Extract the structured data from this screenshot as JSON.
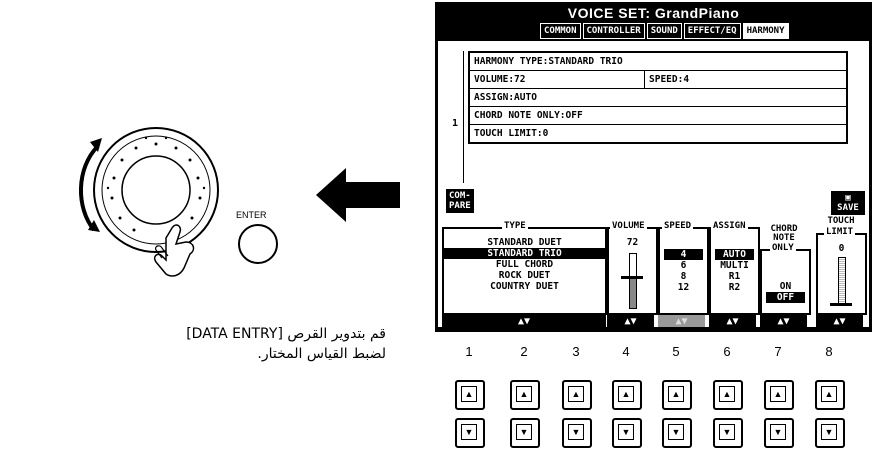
{
  "dial": {
    "enter_label": "ENTER"
  },
  "caption": {
    "line1": "قم بتدوير القرص [DATA ENTRY]",
    "line2": "لضبط القياس المختار."
  },
  "screen": {
    "title": "VOICE SET: GrandPiano",
    "tabs": [
      {
        "label": "COMMON",
        "state": "normal"
      },
      {
        "label": "CONTROLLER",
        "state": "normal"
      },
      {
        "label": "SOUND",
        "state": "normal"
      },
      {
        "label": "EFFECT/EQ",
        "state": "normal"
      },
      {
        "label": "HARMONY",
        "state": "active"
      }
    ],
    "index": "1",
    "rows": {
      "harmony_type": "HARMONY TYPE:STANDARD TRIO",
      "volume": "VOLUME:72",
      "speed": "SPEED:4",
      "assign": "ASSIGN:AUTO",
      "chord_note_only": "CHORD NOTE ONLY:OFF",
      "touch_limit": "TOUCH LIMIT:0"
    },
    "compare_label": "COM-\nPARE",
    "save_label": "SAVE",
    "panels": {
      "type": {
        "label": "TYPE",
        "options": [
          "STANDARD DUET",
          "STANDARD TRIO",
          "FULL CHORD",
          "ROCK DUET",
          "COUNTRY DUET"
        ],
        "selected_index": 1
      },
      "volume": {
        "label": "VOLUME",
        "value": "72",
        "level": 0.57
      },
      "speed": {
        "label": "SPEED",
        "options": [
          "4",
          "6",
          "8",
          "12"
        ],
        "selected_index": 0
      },
      "assign": {
        "label": "ASSIGN",
        "options": [
          "AUTO",
          "MULTI",
          "R1",
          "R2"
        ],
        "selected_index": 0
      },
      "chord": {
        "label1": "CHORD",
        "label2": "NOTE",
        "label3": "ONLY",
        "options": [
          "ON",
          "OFF"
        ],
        "selected_index": 1
      },
      "touch": {
        "label1": "TOUCH",
        "label2": "LIMIT",
        "value": "0",
        "level": 0.0
      }
    },
    "bar_arrows": "▲▼"
  },
  "buttons": {
    "numbers": [
      "1",
      "2",
      "3",
      "4",
      "5",
      "6",
      "7",
      "8"
    ],
    "up_glyph": "▲",
    "down_glyph": "▼"
  }
}
